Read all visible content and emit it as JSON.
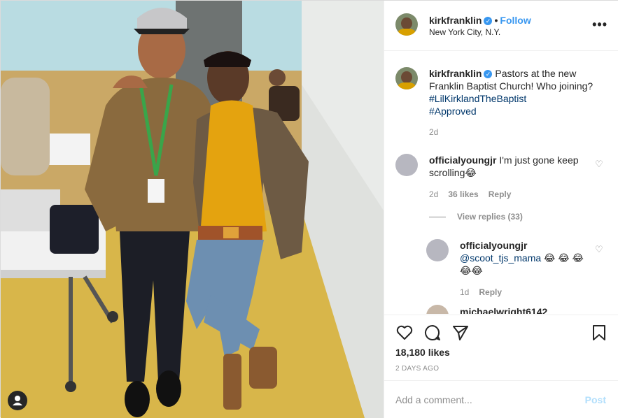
{
  "post": {
    "username": "kirkfranklin",
    "verified_icon": "verified-badge-icon",
    "separator": "•",
    "follow_label": "Follow",
    "location": "New York City, N.Y.",
    "more_icon": "more-options-icon",
    "more_label": "•••"
  },
  "caption": {
    "username": "kirkfranklin",
    "text": "Pastors at the new Franklin Baptist Church! Who joining?",
    "hashtags": [
      "#LilKirklandTheBaptist",
      "#Approved"
    ],
    "age": "2d"
  },
  "comments": [
    {
      "username": "officialyoungjr",
      "text": "I'm just gone keep scrolling😂",
      "age": "2d",
      "likes": "36 likes",
      "reply_label": "Reply",
      "view_replies": "View replies (33)"
    }
  ],
  "replies": [
    {
      "username": "officialyoungjr",
      "mention": "@scoot_tjs_mama",
      "text": "😂 😂 😂😂😂",
      "age": "1d",
      "reply_label": "Reply"
    },
    {
      "username": "michaelwright6142"
    }
  ],
  "actions": {
    "like_icon": "heart-icon",
    "comment_icon": "comment-icon",
    "share_icon": "share-icon",
    "save_icon": "bookmark-icon",
    "likes": "18,180 likes",
    "time": "2 DAYS AGO"
  },
  "add_comment": {
    "placeholder": "Add a comment...",
    "post_label": "Post"
  },
  "colors": {
    "accent": "#3897f0",
    "text": "#262626",
    "muted": "#8e8e8e",
    "hashtag": "#00376b",
    "post_disabled": "#b2dffc"
  }
}
